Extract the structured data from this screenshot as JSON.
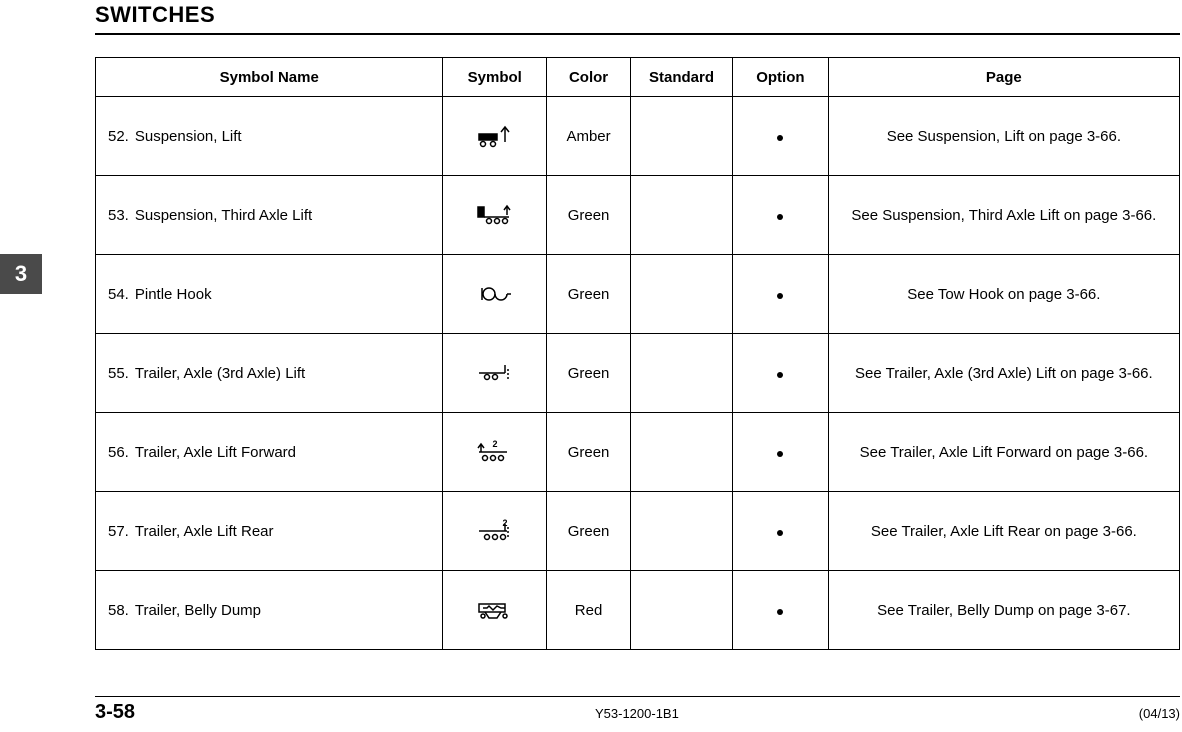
{
  "header": {
    "title": "SWITCHES"
  },
  "sidetab": {
    "label": "3"
  },
  "table": {
    "headers": {
      "name": "Symbol Name",
      "symbol": "Symbol",
      "color": "Color",
      "standard": "Standard",
      "option": "Option",
      "page": "Page"
    },
    "rows": [
      {
        "num": "52.",
        "name": "Suspension, Lift",
        "icon": "suspension-lift-icon",
        "color": "Amber",
        "standard": "",
        "option": true,
        "page": "See Suspension, Lift on page 3-66."
      },
      {
        "num": "53.",
        "name": "Suspension, Third Axle Lift",
        "icon": "suspension-third-axle-icon",
        "color": "Green",
        "standard": "",
        "option": true,
        "page": "See Suspension, Third Axle Lift on page 3-66."
      },
      {
        "num": "54.",
        "name": "Pintle Hook",
        "icon": "pintle-hook-icon",
        "color": "Green",
        "standard": "",
        "option": true,
        "page": "See Tow Hook on page 3-66."
      },
      {
        "num": "55.",
        "name": "Trailer, Axle (3rd Axle) Lift",
        "icon": "trailer-3rd-axle-lift-icon",
        "color": "Green",
        "standard": "",
        "option": true,
        "page": "See Trailer, Axle (3rd Axle) Lift on page 3-66."
      },
      {
        "num": "56.",
        "name": "Trailer, Axle Lift Forward",
        "icon": "trailer-axle-lift-fwd-icon",
        "color": "Green",
        "standard": "",
        "option": true,
        "page": "See Trailer, Axle Lift Forward on page 3-66."
      },
      {
        "num": "57.",
        "name": "Trailer, Axle Lift Rear",
        "icon": "trailer-axle-lift-rear-icon",
        "color": "Green",
        "standard": "",
        "option": true,
        "page": "See Trailer, Axle Lift Rear on page 3-66."
      },
      {
        "num": "58.",
        "name": "Trailer, Belly Dump",
        "icon": "trailer-belly-dump-icon",
        "color": "Red",
        "standard": "",
        "option": true,
        "page": "See Trailer, Belly Dump on page 3-67."
      }
    ]
  },
  "footer": {
    "page_number": "3-58",
    "doc_id": "Y53-1200-1B1",
    "date": "(04/13)"
  }
}
